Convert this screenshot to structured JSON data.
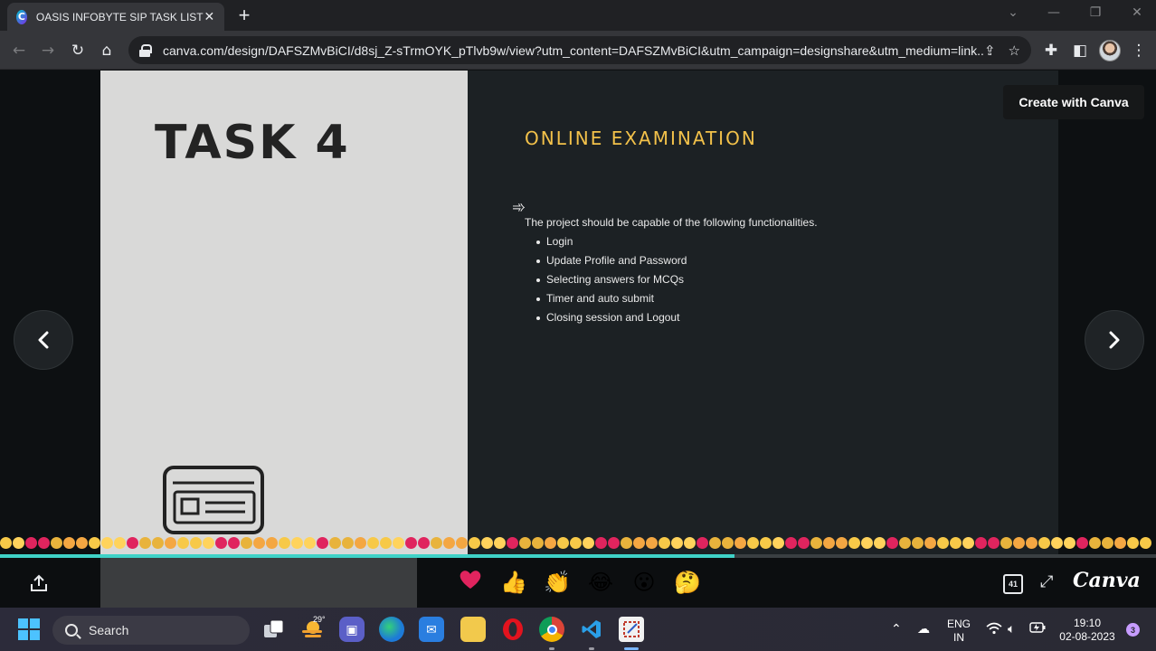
{
  "browser": {
    "tab_title": "OASIS INFOBYTE SIP TASK LIST",
    "tab_close": "✕",
    "new_tab": "+",
    "url": "canva.com/design/DAFSZMvBiCI/d8sj_Z-sTrmOYK_pTlvb9w/view?utm_content=DAFSZMvBiCI&utm_campaign=designshare&utm_medium=link..."
  },
  "slide": {
    "task_title": "TASK 4",
    "section_title": "ONLINE EXAMINATION",
    "intro": "The project should be capable of the following functionalities.",
    "functionalities": [
      "Login",
      "Update Profile and Password",
      "Selecting answers for MCQs",
      "Timer and auto submit",
      "Closing session and Logout"
    ]
  },
  "viewer": {
    "create_button": "Create with Canva",
    "page_count": "41",
    "brand": "Canva",
    "progress": 0.635,
    "reactions": [
      "heart",
      "thumbs-up",
      "clap",
      "laugh",
      "surprised",
      "thinking"
    ]
  },
  "taskbar": {
    "search_label": "Search",
    "temperature": "29°",
    "language_top": "ENG",
    "language_bottom": "IN",
    "time": "19:10",
    "date": "02-08-2023",
    "notification_count": "3"
  },
  "colors": {
    "accent_yellow": "#f2c14a",
    "slide_left_bg": "#d9d9d8",
    "slide_right_bg": "#1c2124",
    "progress": "#3fd2c7",
    "heart": "#e0245e"
  }
}
